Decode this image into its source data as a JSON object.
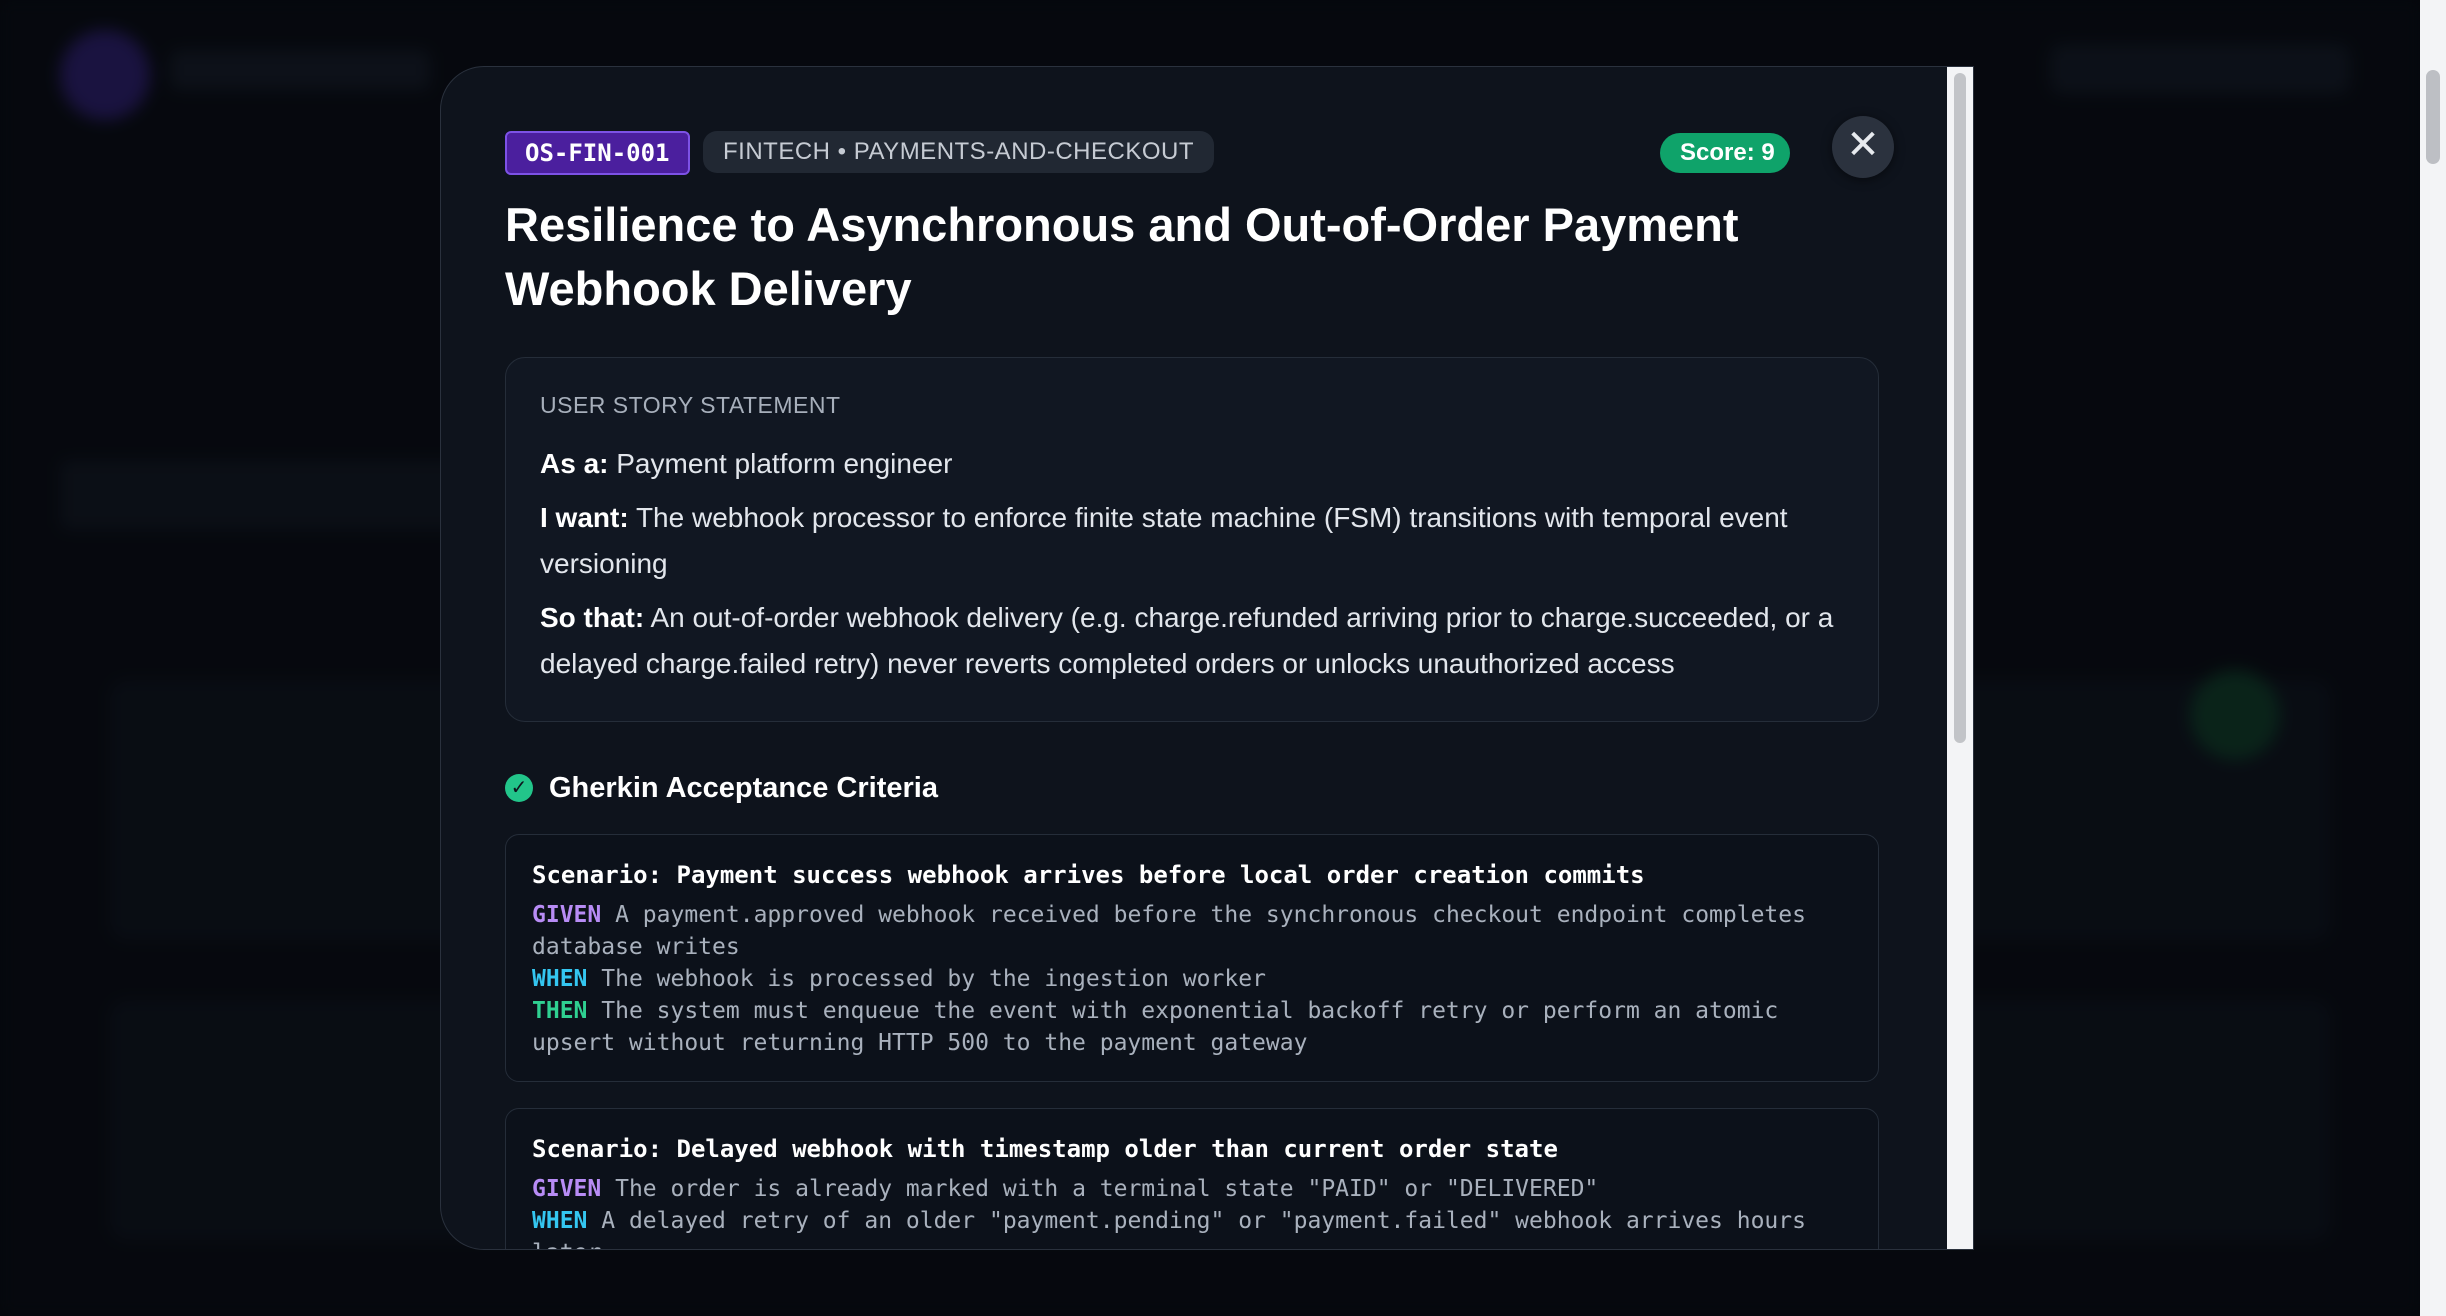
{
  "modal": {
    "id_badge": "OS-FIN-001",
    "category_badge": "FINTECH • PAYMENTS-AND-CHECKOUT",
    "score_badge": "Score: 9",
    "close_glyph": "✕",
    "title": "Resilience to Asynchronous and Out-of-Order Payment Webhook Delivery",
    "user_story": {
      "heading": "USER STORY STATEMENT",
      "as_a_label": "As a:",
      "as_a": "Payment platform engineer",
      "i_want_label": "I want:",
      "i_want": "The webhook processor to enforce finite state machine (FSM) transitions with temporal event versioning",
      "so_that_label": "So that:",
      "so_that": "An out-of-order webhook delivery (e.g. charge.refunded arriving prior to charge.succeeded, or a delayed charge.failed retry) never reverts completed orders or unlocks unauthorized access"
    },
    "criteria": {
      "icon": "check-circle-icon",
      "check_glyph": "✓",
      "heading": "Gherkin Acceptance Criteria",
      "scenarios": [
        {
          "title": "Scenario: Payment success webhook arrives before local order creation commits",
          "given_kw": "GIVEN",
          "given": "A payment.approved webhook received before the synchronous checkout endpoint completes database writes",
          "when_kw": "WHEN",
          "when": "The webhook is processed by the ingestion worker",
          "then_kw": "THEN",
          "then": "The system must enqueue the event with exponential backoff retry or perform an atomic upsert without returning HTTP 500 to the payment gateway"
        },
        {
          "title": "Scenario: Delayed webhook with timestamp older than current order state",
          "given_kw": "GIVEN",
          "given": "The order is already marked with a terminal state \"PAID\" or \"DELIVERED\"",
          "when_kw": "WHEN",
          "when": "A delayed retry of an older \"payment.pending\" or \"payment.failed\" webhook arrives hours later"
        }
      ]
    }
  },
  "colors": {
    "id_badge_bg": "#4b1f9e",
    "score_badge_bg": "#0fa36a",
    "given": "#b88cf5",
    "when": "#34c6f0",
    "then": "#2fd091"
  }
}
